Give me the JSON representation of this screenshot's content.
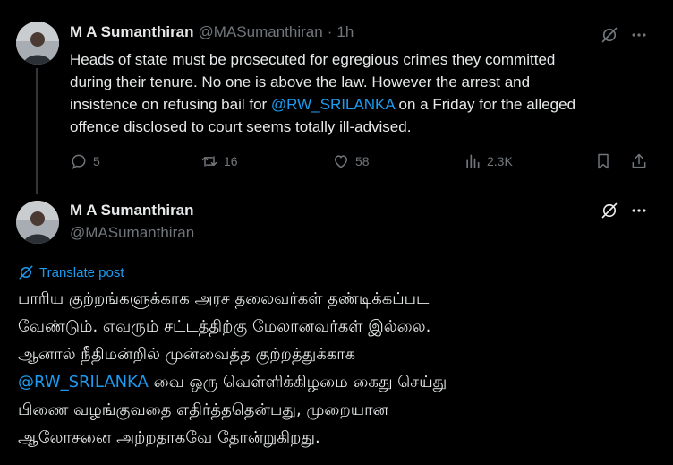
{
  "tweet1": {
    "author_name": "M A Sumanthiran",
    "author_handle": "@MASumanthiran",
    "separator": "·",
    "time": "1h",
    "text_lines": [
      "Heads of state must be prosecuted for egregious crimes they committed",
      "during their tenure. No one is above the law. However the arrest and"
    ],
    "line3_pre": "insistence on refusing bail for ",
    "mention": "@RW_SRILANKA",
    "line3_post": " on a Friday for the alleged",
    "line4": "offence disclosed to court seems totally ill-advised.",
    "replies": "5",
    "reposts": "16",
    "likes": "58",
    "views": "2.3K"
  },
  "tweet2": {
    "author_name": "M A Sumanthiran",
    "author_handle": "@MASumanthiran",
    "translate_label": "Translate post",
    "line1": "பாரிய குற்றங்களுக்காக அரச தலைவர்கள் தண்டிக்கப்பட",
    "line2": "வேண்டும். எவரும் சட்டத்திற்கு மேலானவர்கள் இல்லை.",
    "line3": "ஆனால் நீதிமன்றில் முன்வைத்த குற்றத்துக்காக",
    "mention": "@RW_SRILANKA",
    "line4_post": " வை ஒரு வெள்ளிக்கிழமை கைது செய்து",
    "line5": "பிணை வழங்குவதை எதிர்த்ததென்பது, முறையான",
    "line6": "ஆலோசனை அற்றதாகவே தோன்றுகிறது."
  },
  "icons": {
    "grok": "grok-icon",
    "more": "more-icon",
    "reply": "reply-icon",
    "repost": "repost-icon",
    "like": "like-icon",
    "views": "views-icon",
    "bookmark": "bookmark-icon",
    "share": "share-icon",
    "translate": "translate-icon"
  },
  "colors": {
    "background": "#000000",
    "text": "#e7e9ea",
    "secondary": "#71767b",
    "accent": "#1d9bf0"
  }
}
